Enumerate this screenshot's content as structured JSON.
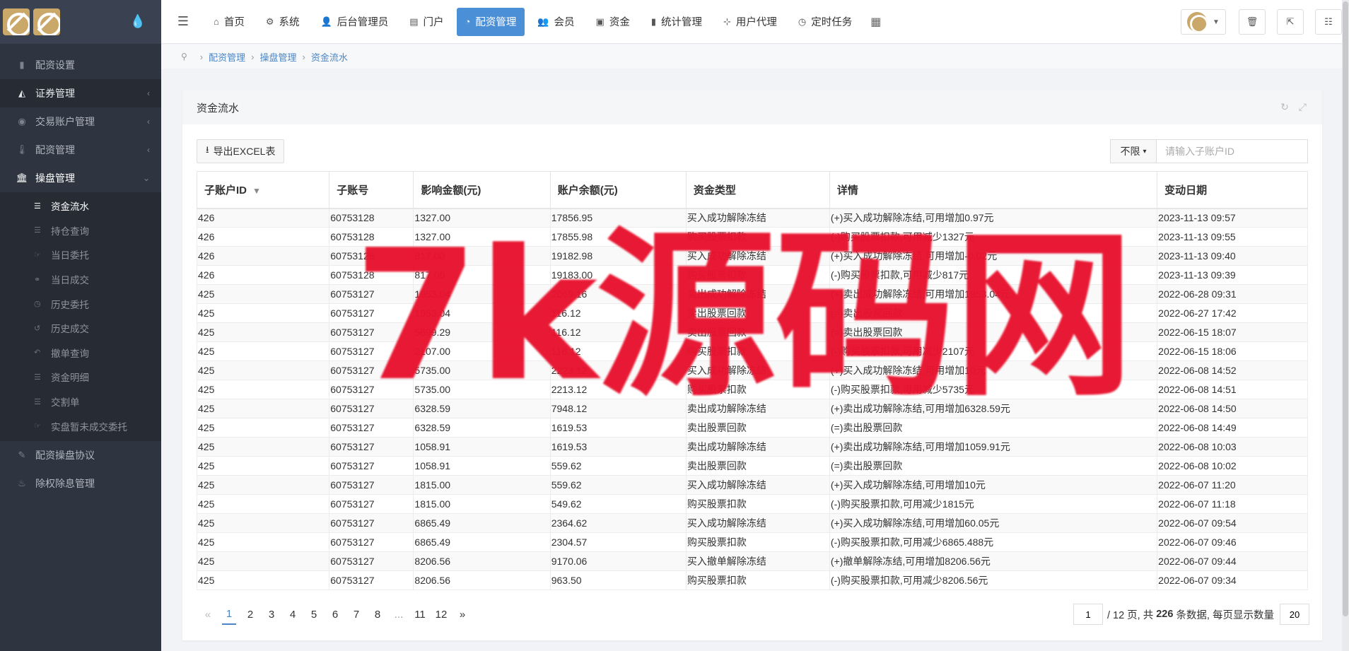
{
  "sidebar": {
    "items": [
      {
        "label": "配资设置",
        "icon": "bar-chart-icon",
        "arrow": ""
      },
      {
        "label": "证券管理",
        "icon": "area-chart-icon",
        "arrow": "‹"
      },
      {
        "label": "交易账户管理",
        "icon": "user-circle-icon",
        "arrow": "‹"
      },
      {
        "label": "配资管理",
        "icon": "thermometer-icon",
        "arrow": "‹"
      },
      {
        "label": "操盘管理",
        "icon": "bank-icon",
        "arrow": "⌄"
      }
    ],
    "subitems": [
      {
        "label": "资金流水",
        "icon": "list-icon"
      },
      {
        "label": "持仓查询",
        "icon": "list-icon"
      },
      {
        "label": "当日委托",
        "icon": "hand-icon"
      },
      {
        "label": "当日成交",
        "icon": "handshake-icon"
      },
      {
        "label": "历史委托",
        "icon": "clock-icon"
      },
      {
        "label": "历史成交",
        "icon": "history-icon"
      },
      {
        "label": "撤单查询",
        "icon": "undo-icon"
      },
      {
        "label": "资金明细",
        "icon": "list-icon"
      },
      {
        "label": "交割单",
        "icon": "list-icon"
      },
      {
        "label": "实盘暂未成交委托",
        "icon": "hand-icon"
      }
    ],
    "bottom_items": [
      {
        "label": "配资操盘协议",
        "icon": "pencil-icon"
      },
      {
        "label": "除权除息管理",
        "icon": "fire-icon"
      }
    ]
  },
  "topnav": {
    "tabs": [
      {
        "label": "首页",
        "icon": "home-icon"
      },
      {
        "label": "系统",
        "icon": "gear-icon"
      },
      {
        "label": "后台管理员",
        "icon": "user-icon"
      },
      {
        "label": "门户",
        "icon": "newspaper-icon"
      },
      {
        "label": "配资管理",
        "icon": "pie-chart-icon"
      },
      {
        "label": "会员",
        "icon": "users-icon"
      },
      {
        "label": "资金",
        "icon": "money-icon"
      },
      {
        "label": "统计管理",
        "icon": "bar-chart-icon"
      },
      {
        "label": "用户代理",
        "icon": "sitemap-icon"
      },
      {
        "label": "定时任务",
        "icon": "clock-icon"
      }
    ],
    "active_tab": "配资管理"
  },
  "breadcrumb": [
    "配资管理",
    "操盘管理",
    "资金流水"
  ],
  "panel": {
    "title": "资金流水",
    "export_label": "导出EXCEL表",
    "filter_select": "不限",
    "search_placeholder": "请输入子账户ID"
  },
  "table": {
    "headers": [
      "子账户ID",
      "子账号",
      "影响金额(元)",
      "账户余额(元)",
      "资金类型",
      "详情",
      "变动日期"
    ],
    "rows": [
      [
        "426",
        "60753128",
        "1327.00",
        "17856.95",
        "买入成功解除冻结",
        "(+)买入成功解除冻结,可用增加0.97元",
        "2023-11-13 09:57"
      ],
      [
        "426",
        "60753128",
        "1327.00",
        "17855.98",
        "购买股票扣款",
        "(-)购买股票扣款,可用减少1327元",
        "2023-11-13 09:55"
      ],
      [
        "426",
        "60753128",
        "817.00",
        "19182.98",
        "买入成功解除冻结",
        "(+)买入成功解除冻结,可用增加-0.02元",
        "2023-11-13 09:40"
      ],
      [
        "426",
        "60753128",
        "817.00",
        "19183.00",
        "购买股票扣款",
        "(-)购买股票扣款,可用减少817元",
        "2023-11-13 09:39"
      ],
      [
        "425",
        "60753127",
        "1953.04",
        "2069.16",
        "卖出成功解除冻结",
        "(+)卖出成功解除冻结,可用增加1953.04元",
        "2022-06-28 09:31"
      ],
      [
        "425",
        "60753127",
        "1953.04",
        "116.12",
        "卖出股票回款",
        "(=)卖出股票回款",
        "2022-06-27 17:42"
      ],
      [
        "425",
        "60753127",
        "5699.29",
        "116.12",
        "卖出股票回款",
        "(=)卖出股票回款",
        "2022-06-15 18:07"
      ],
      [
        "425",
        "60753127",
        "2107.00",
        "116.12",
        "购买股票扣款",
        "(-)购买股票扣款,可用减少2107元",
        "2022-06-15 18:06"
      ],
      [
        "425",
        "60753127",
        "5735.00",
        "2223.12",
        "买入成功解除冻结",
        "(+)买入成功解除冻结,可用增加10元",
        "2022-06-08 14:52"
      ],
      [
        "425",
        "60753127",
        "5735.00",
        "2213.12",
        "购买股票扣款",
        "(-)购买股票扣款,可用减少5735元",
        "2022-06-08 14:51"
      ],
      [
        "425",
        "60753127",
        "6328.59",
        "7948.12",
        "卖出成功解除冻结",
        "(+)卖出成功解除冻结,可用增加6328.59元",
        "2022-06-08 14:50"
      ],
      [
        "425",
        "60753127",
        "6328.59",
        "1619.53",
        "卖出股票回款",
        "(=)卖出股票回款",
        "2022-06-08 14:49"
      ],
      [
        "425",
        "60753127",
        "1058.91",
        "1619.53",
        "卖出成功解除冻结",
        "(+)卖出成功解除冻结,可用增加1059.91元",
        "2022-06-08 10:03"
      ],
      [
        "425",
        "60753127",
        "1058.91",
        "559.62",
        "卖出股票回款",
        "(=)卖出股票回款",
        "2022-06-08 10:02"
      ],
      [
        "425",
        "60753127",
        "1815.00",
        "559.62",
        "买入成功解除冻结",
        "(+)买入成功解除冻结,可用增加10元",
        "2022-06-07 11:20"
      ],
      [
        "425",
        "60753127",
        "1815.00",
        "549.62",
        "购买股票扣款",
        "(-)购买股票扣款,可用减少1815元",
        "2022-06-07 11:18"
      ],
      [
        "425",
        "60753127",
        "6865.49",
        "2364.62",
        "买入成功解除冻结",
        "(+)买入成功解除冻结,可用增加60.05元",
        "2022-06-07 09:54"
      ],
      [
        "425",
        "60753127",
        "6865.49",
        "2304.57",
        "购买股票扣款",
        "(-)购买股票扣款,可用减少6865.488元",
        "2022-06-07 09:46"
      ],
      [
        "425",
        "60753127",
        "8206.56",
        "9170.06",
        "买入撤单解除冻结",
        "(+)撤单解除冻结,可用增加8206.56元",
        "2022-06-07 09:44"
      ],
      [
        "425",
        "60753127",
        "8206.56",
        "963.50",
        "购买股票扣款",
        "(-)购买股票扣款,可用减少8206.56元",
        "2022-06-07 09:34"
      ]
    ]
  },
  "pagination": {
    "prev": "«",
    "pages": [
      "1",
      "2",
      "3",
      "4",
      "5",
      "6",
      "7",
      "8",
      "...",
      "11",
      "12"
    ],
    "next": "»",
    "current": "1",
    "page_input": "1",
    "total_pages_text": "/ 12 页, 共",
    "total_records": "226",
    "records_text": "条数据, 每页显示数量",
    "page_size": "20"
  },
  "watermark": "7k源码网",
  "colors": {
    "sidebar_bg": "#2f3540",
    "active_tab": "#4b8fd6",
    "link": "#4a86c5",
    "watermark": "#e8122e"
  }
}
